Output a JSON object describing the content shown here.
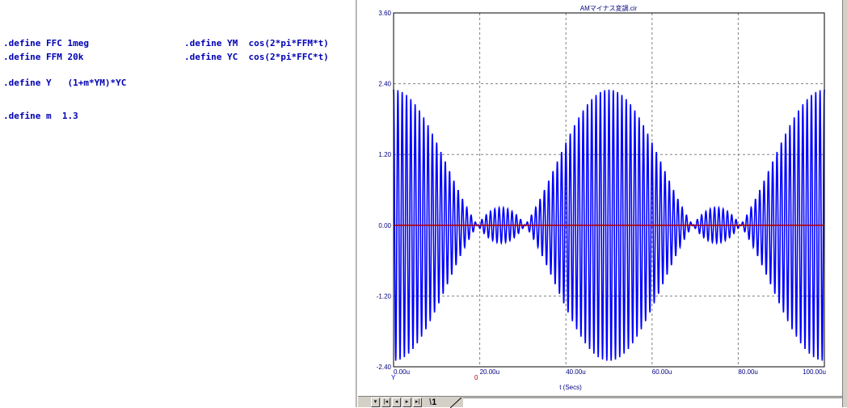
{
  "defines": [
    ".define FFC 1meg",
    ".define FFM 20k",
    ".define YM  cos(2*pi*FFM*t)",
    ".define YC  cos(2*pi*FFC*t)",
    ".define Y   (1+m*YM)*YC",
    ".define m  1.3"
  ],
  "plot": {
    "title": "AMマイナス変調.cir",
    "x_axis_label": "t (Secs)",
    "x_tick_labels": [
      "0.00u",
      "20.00u",
      "40.00u",
      "60.00u",
      "80.00u",
      "100.00u"
    ],
    "y_tick_labels": [
      "3.60",
      "2.40",
      "1.20",
      "0.00",
      "-1.20",
      "-2.40"
    ],
    "series_labels": [
      "Y",
      "0"
    ]
  },
  "colors": {
    "define_text": "#0000b4",
    "series_y": "#0000ff",
    "series_zero": "#b40000",
    "axis_text": "#000080"
  },
  "chart_data": {
    "type": "line",
    "title": "AMマイナス変調.cir",
    "xlabel": "t (Secs)",
    "ylabel": "",
    "xlim": [
      0,
      100
    ],
    "ylim": [
      -2.4,
      3.6
    ],
    "x_unit": "u",
    "yticks": [
      3.6,
      2.4,
      1.2,
      0.0,
      -1.2,
      -2.4
    ],
    "xticks": [
      0,
      20,
      40,
      60,
      80,
      100
    ],
    "grid": true,
    "series": [
      {
        "name": "Y",
        "expression": "(1+m*YM)*YC",
        "m": 1.3,
        "carrier_hz": 1000000,
        "modulation_hz": 20000,
        "peak": 2.3
      },
      {
        "name": "0",
        "constant": 0.0
      }
    ],
    "legend": "bottom-left"
  },
  "tabs": {
    "active_label": "1",
    "nav_buttons": [
      "▾",
      "|◂",
      "◂",
      "▸",
      "▸|"
    ]
  }
}
